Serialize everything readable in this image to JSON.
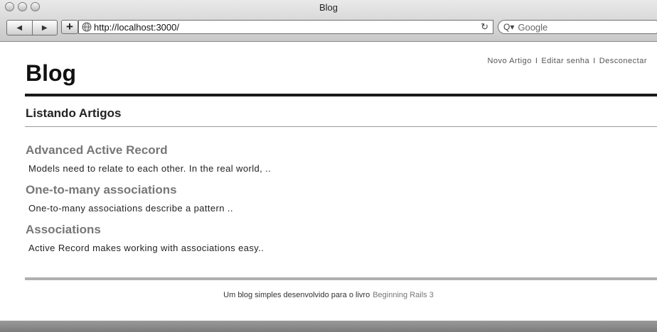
{
  "window": {
    "title": "Blog"
  },
  "toolbar": {
    "back_icon": "◀",
    "forward_icon": "▶",
    "add_icon": "+",
    "url": "http://localhost:3000/",
    "reload_icon": "↻",
    "search_placeholder": "Google",
    "search_icon": "Q▾"
  },
  "header": {
    "brand": "Blog",
    "nav": {
      "new_article": "Novo Artigo",
      "separator": "I",
      "edit_password": "Editar senha",
      "logout": "Desconectar"
    }
  },
  "main": {
    "title": "Listando Artigos",
    "articles": [
      {
        "title": "Advanced Active Record",
        "excerpt": "Models need to relate to each other. In the real world, .."
      },
      {
        "title": "One-to-many associations",
        "excerpt": "One-to-many associations describe a pattern .."
      },
      {
        "title": "Associations",
        "excerpt": "Active Record makes working with associations easy.."
      }
    ]
  },
  "footer": {
    "text": "Um blog simples desenvolvido para o livro",
    "link": "Beginning Rails 3"
  },
  "colors": {
    "heading_rule": "#1a1a1a",
    "article_title": "#777777",
    "footer_rule": "#b0b0b0"
  }
}
